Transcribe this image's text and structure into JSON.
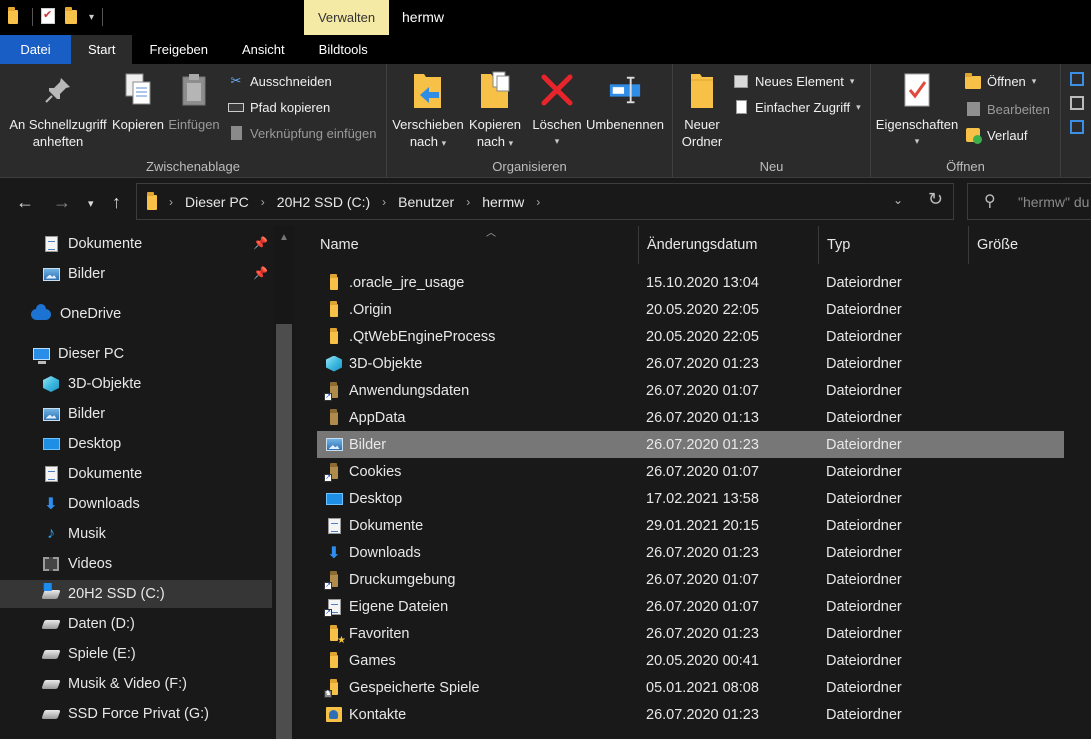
{
  "titlebar": {
    "contextual_tab": "Verwalten",
    "title": "hermw"
  },
  "ribbon_tabs": [
    "Datei",
    "Start",
    "Freigeben",
    "Ansicht",
    "Bildtools"
  ],
  "ribbon": {
    "zwischenablage": {
      "label": "Zwischenablage",
      "pin": "An Schnellzugriff anheften",
      "pin_l1": "An Schnellzugriff",
      "pin_l2": "anheften",
      "copy": "Kopieren",
      "paste": "Einfügen",
      "cut": "Ausschneiden",
      "copy_path": "Pfad kopieren",
      "paste_shortcut": "Verknüpfung einfügen"
    },
    "organisieren": {
      "label": "Organisieren",
      "move_l1": "Verschieben",
      "move_l2": "nach",
      "copyto_l1": "Kopieren",
      "copyto_l2": "nach",
      "delete": "Löschen",
      "rename": "Umbenennen"
    },
    "neu": {
      "label": "Neu",
      "newfolder_l1": "Neuer",
      "newfolder_l2": "Ordner",
      "new_item": "Neues Element",
      "easy_access": "Einfacher Zugriff"
    },
    "oeffnen": {
      "label": "Öffnen",
      "properties": "Eigenschaften",
      "open": "Öffnen",
      "edit": "Bearbeiten",
      "history": "Verlauf"
    }
  },
  "address": {
    "crumbs": [
      "Dieser PC",
      "20H2 SSD (C:)",
      "Benutzer",
      "hermw"
    ],
    "search_placeholder": "\"hermw\" du"
  },
  "nav": {
    "items": [
      {
        "label": "Dokumente",
        "icon": "documents-icon",
        "pinned": true
      },
      {
        "label": "Bilder",
        "icon": "pictures-icon",
        "pinned": true
      },
      {
        "label": "OneDrive",
        "icon": "onedrive-icon"
      },
      {
        "label": "Dieser PC",
        "icon": "this-pc-icon"
      },
      {
        "label": "3D-Objekte",
        "icon": "3d-objects-icon"
      },
      {
        "label": "Bilder",
        "icon": "pictures-icon"
      },
      {
        "label": "Desktop",
        "icon": "desktop-icon"
      },
      {
        "label": "Dokumente",
        "icon": "documents-icon"
      },
      {
        "label": "Downloads",
        "icon": "downloads-icon"
      },
      {
        "label": "Musik",
        "icon": "music-icon"
      },
      {
        "label": "Videos",
        "icon": "videos-icon"
      },
      {
        "label": "20H2 SSD (C:)",
        "icon": "system-drive-icon",
        "selected": true
      },
      {
        "label": "Daten (D:)",
        "icon": "drive-icon"
      },
      {
        "label": "Spiele (E:)",
        "icon": "drive-icon"
      },
      {
        "label": "Musik & Video (F:)",
        "icon": "drive-icon"
      },
      {
        "label": "SSD Force Privat (G:)",
        "icon": "drive-icon"
      }
    ]
  },
  "files": {
    "columns": [
      "Name",
      "Änderungsdatum",
      "Typ",
      "Größe"
    ],
    "rows": [
      {
        "name": ".oracle_jre_usage",
        "date": "15.10.2020 13:04",
        "type": "Dateiordner",
        "icon": "folder-icon"
      },
      {
        "name": ".Origin",
        "date": "20.05.2020 22:05",
        "type": "Dateiordner",
        "icon": "folder-icon"
      },
      {
        "name": ".QtWebEngineProcess",
        "date": "20.05.2020 22:05",
        "type": "Dateiordner",
        "icon": "folder-icon"
      },
      {
        "name": "3D-Objekte",
        "date": "26.07.2020 01:23",
        "type": "Dateiordner",
        "icon": "3d-objects-icon"
      },
      {
        "name": "Anwendungsdaten",
        "date": "26.07.2020 01:07",
        "type": "Dateiordner",
        "icon": "junction-folder-icon"
      },
      {
        "name": "AppData",
        "date": "26.07.2020 01:13",
        "type": "Dateiordner",
        "icon": "hidden-folder-icon"
      },
      {
        "name": "Bilder",
        "date": "26.07.2020 01:23",
        "type": "Dateiordner",
        "icon": "pictures-icon",
        "selected": true
      },
      {
        "name": "Cookies",
        "date": "26.07.2020 01:07",
        "type": "Dateiordner",
        "icon": "junction-folder-icon"
      },
      {
        "name": "Desktop",
        "date": "17.02.2021 13:58",
        "type": "Dateiordner",
        "icon": "desktop-icon"
      },
      {
        "name": "Dokumente",
        "date": "29.01.2021 20:15",
        "type": "Dateiordner",
        "icon": "documents-icon"
      },
      {
        "name": "Downloads",
        "date": "26.07.2020 01:23",
        "type": "Dateiordner",
        "icon": "downloads-icon"
      },
      {
        "name": "Druckumgebung",
        "date": "26.07.2020 01:07",
        "type": "Dateiordner",
        "icon": "junction-folder-icon"
      },
      {
        "name": "Eigene Dateien",
        "date": "26.07.2020 01:07",
        "type": "Dateiordner",
        "icon": "junction-doc-icon"
      },
      {
        "name": "Favoriten",
        "date": "26.07.2020 01:23",
        "type": "Dateiordner",
        "icon": "favorites-icon"
      },
      {
        "name": "Games",
        "date": "20.05.2020 00:41",
        "type": "Dateiordner",
        "icon": "folder-icon"
      },
      {
        "name": "Gespeicherte Spiele",
        "date": "05.01.2021 08:08",
        "type": "Dateiordner",
        "icon": "saved-games-icon"
      },
      {
        "name": "Kontakte",
        "date": "26.07.2020 01:23",
        "type": "Dateiordner",
        "icon": "contacts-icon"
      }
    ]
  }
}
